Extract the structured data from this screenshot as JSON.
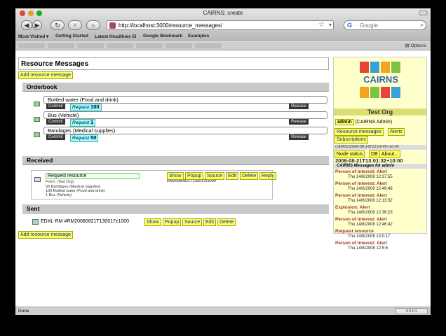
{
  "window": {
    "title": "CAIRNS: create"
  },
  "toolbar": {
    "url": "http://localhost:3000/resource_messages/",
    "search_placeholder": "Google"
  },
  "bookmarks": [
    "Most Visited ▾",
    "Getting Started",
    "Latest Headlines ☊",
    "Google Bookmark",
    "Examples"
  ],
  "tabbar": {
    "options_label": "Options"
  },
  "page": {
    "heading": "Resource Messages",
    "add_link": "Add resource message",
    "orderbook": {
      "title": "Orderbook",
      "items": [
        {
          "name": "Bottled water (Food and drink)",
          "commit": "Commit",
          "request_label": "Request",
          "request_qty": "100",
          "release": "Release"
        },
        {
          "name": "Bus (Vehicle)",
          "commit": "Commit",
          "request_label": "Request",
          "request_qty": "1",
          "release": "Release"
        },
        {
          "name": "Bandages (Medical supplies)",
          "commit": "Commit",
          "request_label": "Request",
          "request_qty": "50",
          "release": "Release"
        }
      ]
    },
    "received": {
      "title": "Received",
      "message": {
        "title": "Request resource",
        "from": "From: (Test Org)",
        "lines": [
          {
            "qty": "50 Bandages",
            "cat": "(Medical supplies)"
          },
          {
            "qty": "100 Bottled water",
            "cat": "(Food and drink)"
          },
          {
            "qty": "1 Bus",
            "cat": "(Vehicle)"
          }
        ],
        "id": "RM20080821T130017z1000",
        "actions": [
          "Show",
          "Popup",
          "Source",
          "Edit",
          "Delete",
          "Reply"
        ]
      }
    },
    "sent": {
      "title": "Sent",
      "text": "EDXL-RM #RM20080821T130017z1000",
      "actions": [
        "Show",
        "Popup",
        "Source",
        "Edit",
        "Delete"
      ]
    },
    "add_link_bottom": "Add resource message"
  },
  "sidebar": {
    "logo_text": "CAIRNS",
    "org": "Test Org",
    "user_button": "admin",
    "user_role": "(CAIRNS Admin)",
    "links": [
      "Resource messages",
      "Alerts",
      "Subscriptions"
    ],
    "stamp": "CAIRNS2008-08-14T12:04:45+10:00",
    "node_buttons": [
      "Node status",
      "DB",
      "About..."
    ],
    "node_time": "2008-08-21T13:01:32+10:00",
    "messages_header": "CAIRNS Messages for admin",
    "messages": [
      {
        "title": "Person of Interest: Alert",
        "date": "Thu 14/8/2008 12:37:55"
      },
      {
        "title": "Person of Interest: Alert",
        "date": "Thu 14/8/2008 12:49:46"
      },
      {
        "title": "Person of Interest: Alert",
        "date": "Thu 14/8/2008 12:13:32"
      },
      {
        "title": "Explosion: Alert",
        "date": "Thu 14/8/2008 12:36:23"
      },
      {
        "title": "Person of Interest: Alert",
        "date": "Thu 14/8/2008 12:46:42"
      },
      {
        "title": "Request resource",
        "date": "Thu 14/8/2008 13:0:17"
      },
      {
        "title": "Person of Interest: Alert",
        "date": "Thu 14/8/2008 12:5:6"
      }
    ]
  },
  "statusbar": {
    "text": "Done",
    "badge": "0 0 0 L"
  },
  "colors": {
    "button_yellow": "#ffff66",
    "sidebar_bg": "#ffffcc",
    "alert_red": "#993333",
    "request_cyan": "#99ffff"
  }
}
